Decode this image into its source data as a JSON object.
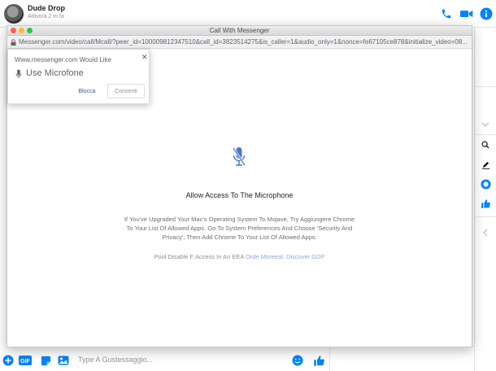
{
  "header": {
    "contact_name": "Dude Drop",
    "contact_status": "Attivo/a 2 m fa",
    "icons": [
      "phone-icon",
      "video-camera-icon",
      "info-icon"
    ],
    "accent_color": "#0084ff"
  },
  "popup": {
    "window_title": "Call With Messenger",
    "url": "Messenger.com/video/call/Mcall/?peer_id=100009812347510&call_id=3823514275&is_caller=1&audio_only=1&nonce=fe67105ce878&initialize_video=08...",
    "permission": {
      "site_text": "Www.messenger.com Would Like",
      "request_text": "Use Microfone",
      "block_label": "Blocca",
      "allow_label": "Consenti"
    },
    "heading": "Allow Access To The Microphone",
    "instructions": "If You've Upgraded Your Mac's Operating System To Mojave, Try Aggiungere Chrome To Your List Of Allowed Apps. Go To System Preferences And Choose 'Security And Privacy', Then Add Chrome To Your List Of Allowed Apps.",
    "footer_prefix": "Pool Disable F Access In An EEA",
    "footer_link": "Orde Moreeal. Discover GDP"
  },
  "composer": {
    "placeholder": "Type A Gustessaggio...",
    "icons": [
      "plus-icon",
      "gif-icon",
      "sticker-icon",
      "photo-icon",
      "emoji-icon",
      "thumbs-up-icon"
    ]
  },
  "right_column": {
    "icons": [
      "chevron-down-icon",
      "search-icon",
      "pencil-icon",
      "theme-color-icon",
      "thumbs-up-icon",
      "chevron-left-icon"
    ]
  }
}
